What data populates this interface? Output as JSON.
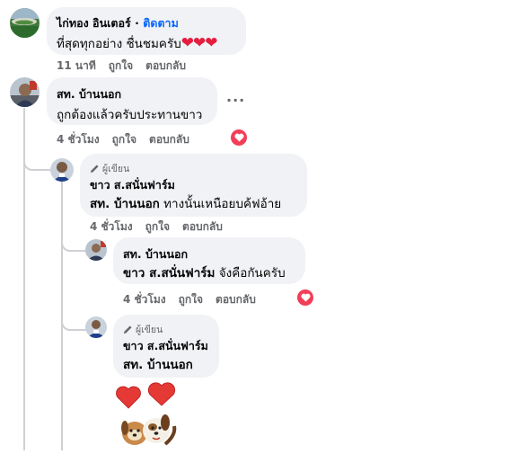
{
  "comments": [
    {
      "author": "ไก่ทอง อินเตอร์",
      "follow_label": "ติดตาม",
      "text": "ที่สุดทุกอย่าง ชื่นชมครับ",
      "emoji": "❤❤❤",
      "time": "11 นาที",
      "like_label": "ถูกใจ",
      "reply_label": "ตอบกลับ"
    },
    {
      "author": "สท. บ้านนอก",
      "text": "ถูกต้องแล้วครับประทานขาว",
      "more_label": "···",
      "time": "4 ชั่วโมง",
      "like_label": "ถูกใจ",
      "reply_label": "ตอบกลับ",
      "reaction": "heart"
    },
    {
      "badge": "ผู้เขียน",
      "author": "ขาว ส.สนั่นฟาร์ม",
      "mention": "สท. บ้านนอก",
      "text": " ทางนั้นเหนือยบค้ฟอ้าย",
      "time": "4 ชั่วโมง",
      "like_label": "ถูกใจ",
      "reply_label": "ตอบกลับ"
    },
    {
      "author": "สท. บ้านนอก",
      "mention": "ขาว ส.สนั่นฟาร์ม",
      "text": " จังคือกันครับ",
      "time": "4 ชั่วโมง",
      "like_label": "ถูกใจ",
      "reply_label": "ตอบกลับ",
      "reaction": "heart"
    },
    {
      "badge": "ผู้เขียน",
      "author": "ขาว ส.สนั่นฟาร์ม",
      "mention": "สท. บ้านนอก",
      "sticker": "dogs-with-hearts-sticker"
    }
  ],
  "colors": {
    "link": "#0866ff",
    "meta": "#65676b",
    "bubble": "#f0f2f5",
    "reaction": "#f33e58",
    "thread": "#ced0d4"
  }
}
